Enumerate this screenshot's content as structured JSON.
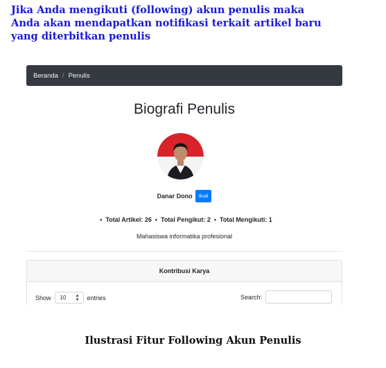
{
  "heading": {
    "line1": "Jika Anda mengikuti (following) akun penulis maka",
    "line2": "Anda akan mendapatkan notifikasi terkait artikel baru",
    "line3": "yang diterbitkan penulis"
  },
  "breadcrumb": {
    "home": "Beranda",
    "separator": "/",
    "current": "Penulis"
  },
  "profile": {
    "title": "Biografi Penulis",
    "name": "Danar Dono",
    "follow_label": "Ikuti",
    "stats": [
      {
        "label": "Total Artikel: 26"
      },
      {
        "label": "Total Pengikut: 2"
      },
      {
        "label": "Total Mengikuti: 1"
      }
    ],
    "bullet": "•",
    "bio": "Mahasiswa informatika profesional"
  },
  "contributions": {
    "title": "Kontribusi Karya",
    "show_label": "Show",
    "entries_value": "10",
    "entries_label": "entries",
    "search_label": "Search:",
    "search_value": ""
  },
  "caption": "Ilustrasi Fitur Following Akun Penulis",
  "colors": {
    "heading": "#1a1ad6",
    "navbar": "#343a40",
    "follow_button": "#007bff"
  }
}
